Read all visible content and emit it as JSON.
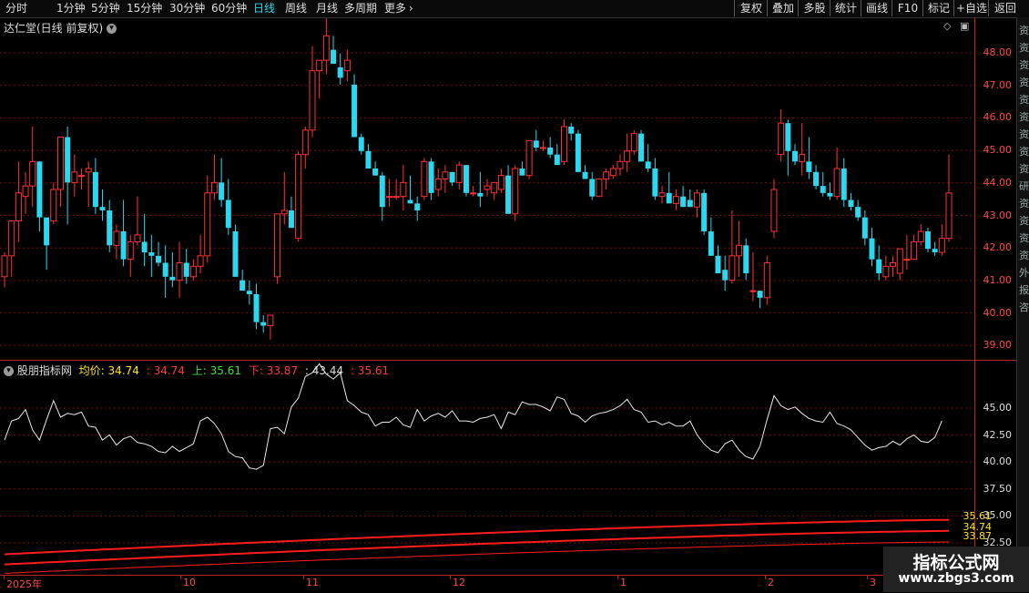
{
  "toolbar": {
    "periods": [
      "分时",
      "1分钟",
      "5分钟",
      "15分钟",
      "30分钟",
      "60分钟",
      "日线",
      "周线",
      "月线",
      "多周期",
      "更多"
    ],
    "active_period": "日线",
    "more_arrow": "›",
    "buttons": [
      "复权",
      "叠加",
      "多股",
      "统计",
      "画线",
      "F10",
      "标记",
      "+自选",
      "返回"
    ]
  },
  "stock": {
    "title": "达仁堂(日线 前复权)",
    "chevron_icon": "chevron-down-icon"
  },
  "top_right_icons": {
    "diamond": "◇",
    "panel": "▣"
  },
  "indicator": {
    "name": "股朋指标网",
    "avg_label": "均价:",
    "avg_value": "34.74",
    "val2": ": 34.74",
    "up_label": "上:",
    "up_value": "35.61",
    "down_label": "下:",
    "down_value": "33.87",
    "val5": ": 43.44",
    "val6": ": 35.61",
    "right_values": [
      "35.61",
      "34.74",
      "33.87"
    ]
  },
  "axes": {
    "price_ticks": [
      "48.00",
      "47.00",
      "46.00",
      "45.00",
      "44.00",
      "43.00",
      "42.00",
      "41.00",
      "40.00",
      "39.00"
    ],
    "indicator_ticks": [
      "45.00",
      "42.50",
      "40.00",
      "37.50",
      "35.00",
      "32.50"
    ],
    "dates": [
      "2025年",
      "10",
      "11",
      "12",
      "1",
      "2",
      "3"
    ]
  },
  "watermark": {
    "title": "指标公式网",
    "url": "www.zbgs3.com"
  },
  "side_strip": [
    "资",
    "资",
    "资",
    "资",
    "资",
    "资",
    "资",
    "资",
    "资",
    "研",
    "资",
    "资",
    "资",
    "资",
    "外",
    "报",
    "咨"
  ],
  "colors": {
    "up": "#ff3232",
    "down": "#2ad8f0",
    "grid": "#7a0e0e",
    "axis": "#b22222",
    "price_line": "#e8e8e8",
    "band": "#ff1c1c",
    "yellow": "#ffe21c"
  },
  "chart_data": [
    {
      "type": "candlestick",
      "title": "达仁堂(日线 前复权)",
      "ylim": [
        38.7,
        48.3
      ],
      "x_labels": [
        "2025年",
        "10",
        "11",
        "12",
        "1",
        "2",
        "3"
      ],
      "ohlc": [
        [
          41.0,
          41.7,
          40.7,
          41.6
        ],
        [
          41.6,
          42.6,
          41.0,
          42.6
        ],
        [
          42.6,
          44.3,
          42.0,
          43.4
        ],
        [
          43.3,
          44.0,
          42.8,
          43.6
        ],
        [
          43.6,
          45.3,
          43.0,
          44.3
        ],
        [
          44.3,
          44.3,
          42.3,
          42.7
        ],
        [
          42.7,
          42.7,
          41.2,
          41.9
        ],
        [
          42.6,
          43.7,
          42.5,
          43.5
        ],
        [
          43.5,
          45.0,
          43.0,
          45.0
        ],
        [
          45.0,
          45.3,
          42.5,
          43.7
        ],
        [
          43.7,
          44.5,
          43.3,
          44.0
        ],
        [
          43.9,
          44.1,
          43.5,
          43.9
        ],
        [
          44.0,
          44.3,
          43.0,
          44.1
        ],
        [
          44.0,
          44.4,
          42.8,
          43.0
        ],
        [
          43.0,
          43.5,
          42.6,
          42.9
        ],
        [
          42.9,
          43.2,
          41.7,
          41.9
        ],
        [
          41.9,
          42.5,
          41.5,
          42.3
        ],
        [
          42.3,
          43.2,
          41.3,
          41.5
        ],
        [
          41.5,
          42.2,
          41.0,
          42.0
        ],
        [
          42.0,
          43.3,
          41.9,
          42.2
        ],
        [
          42.0,
          42.8,
          41.3,
          41.7
        ],
        [
          41.7,
          42.2,
          41.0,
          41.6
        ],
        [
          41.6,
          42.0,
          41.3,
          41.4
        ],
        [
          41.4,
          41.9,
          40.4,
          41.0
        ],
        [
          41.0,
          41.7,
          40.7,
          40.9
        ],
        [
          40.9,
          42.0,
          40.4,
          41.4
        ],
        [
          41.4,
          41.8,
          40.8,
          41.0
        ],
        [
          41.0,
          41.5,
          40.9,
          41.3
        ],
        [
          41.3,
          42.2,
          41.1,
          41.6
        ],
        [
          41.6,
          43.9,
          41.4,
          43.4
        ],
        [
          43.4,
          44.5,
          43.2,
          43.7
        ],
        [
          43.7,
          44.4,
          43.0,
          43.2
        ],
        [
          43.2,
          43.8,
          42.2,
          42.4
        ],
        [
          42.3,
          42.5,
          41.0,
          41.0
        ],
        [
          40.9,
          41.2,
          40.7,
          40.6
        ],
        [
          40.6,
          40.9,
          40.2,
          40.5
        ],
        [
          40.5,
          40.8,
          39.5,
          39.7
        ],
        [
          39.7,
          39.9,
          39.4,
          39.6
        ],
        [
          39.6,
          39.9,
          39.2,
          39.9
        ],
        [
          41.0,
          42.8,
          40.8,
          42.8
        ],
        [
          42.8,
          44.0,
          42.5,
          42.9
        ],
        [
          42.9,
          43.3,
          42.4,
          42.4
        ],
        [
          42.1,
          44.6,
          42.0,
          44.5
        ],
        [
          44.5,
          45.3,
          44.1,
          45.2
        ],
        [
          45.2,
          47.6,
          45.0,
          46.9
        ],
        [
          46.9,
          47.2,
          46.1,
          47.2
        ],
        [
          47.2,
          48.4,
          46.8,
          47.9
        ],
        [
          47.5,
          47.9,
          47.2,
          47.1
        ],
        [
          47.0,
          47.4,
          46.5,
          46.7
        ],
        [
          46.9,
          47.5,
          46.6,
          47.2
        ],
        [
          46.5,
          46.8,
          45.3,
          45.0
        ],
        [
          45.0,
          45.1,
          44.5,
          44.6
        ],
        [
          44.6,
          44.8,
          44.2,
          44.1
        ],
        [
          44.1,
          44.3,
          43.9,
          43.9
        ],
        [
          43.9,
          44.0,
          42.6,
          43.0
        ],
        [
          43.3,
          43.8,
          43.0,
          43.3
        ],
        [
          43.3,
          43.8,
          43.2,
          43.3
        ],
        [
          43.3,
          44.2,
          42.9,
          43.7
        ],
        [
          43.2,
          43.9,
          43.1,
          43.1
        ],
        [
          43.1,
          43.3,
          42.6,
          42.9
        ],
        [
          43.3,
          44.4,
          43.2,
          44.3
        ],
        [
          44.3,
          44.4,
          43.2,
          43.4
        ],
        [
          43.5,
          44.1,
          43.3,
          43.8
        ],
        [
          43.8,
          44.2,
          43.4,
          44.0
        ],
        [
          44.0,
          44.0,
          43.6,
          43.7
        ],
        [
          43.7,
          44.3,
          43.5,
          44.2
        ],
        [
          44.2,
          44.2,
          43.3,
          43.4
        ],
        [
          43.4,
          43.6,
          43.3,
          43.4
        ],
        [
          43.4,
          44.0,
          43.0,
          43.3
        ],
        [
          43.5,
          43.8,
          43.3,
          43.6
        ],
        [
          43.4,
          43.7,
          43.2,
          43.7
        ],
        [
          43.5,
          44.1,
          43.4,
          43.9
        ],
        [
          43.9,
          44.2,
          43.1,
          42.8
        ],
        [
          42.8,
          44.2,
          42.6,
          44.1
        ],
        [
          44.1,
          44.3,
          43.9,
          43.9
        ],
        [
          43.9,
          44.9,
          43.8,
          44.9
        ],
        [
          44.9,
          45.2,
          44.6,
          44.7
        ],
        [
          44.7,
          44.9,
          44.6,
          44.7
        ],
        [
          44.7,
          45.0,
          44.4,
          44.5
        ],
        [
          44.5,
          44.8,
          44.3,
          44.2
        ],
        [
          44.3,
          45.5,
          44.2,
          45.3
        ],
        [
          45.3,
          45.4,
          44.9,
          45.1
        ],
        [
          45.1,
          45.2,
          44.1,
          44.0
        ],
        [
          44.0,
          44.2,
          43.9,
          43.8
        ],
        [
          43.8,
          44.0,
          43.2,
          43.3
        ],
        [
          43.3,
          43.8,
          43.3,
          43.8
        ],
        [
          43.8,
          44.1,
          43.5,
          44.0
        ],
        [
          43.9,
          44.2,
          43.8,
          44.1
        ],
        [
          44.1,
          44.5,
          43.9,
          44.3
        ],
        [
          44.3,
          45.1,
          44.0,
          44.6
        ],
        [
          44.6,
          45.2,
          44.5,
          45.1
        ],
        [
          45.1,
          45.2,
          44.3,
          44.3
        ],
        [
          44.3,
          44.8,
          44.0,
          44.1
        ],
        [
          44.1,
          44.4,
          43.2,
          43.3
        ],
        [
          43.3,
          43.6,
          43.1,
          43.4
        ],
        [
          43.4,
          44.0,
          43.2,
          43.1
        ],
        [
          43.1,
          43.5,
          42.9,
          43.3
        ],
        [
          43.3,
          43.6,
          43.0,
          43.0
        ],
        [
          43.2,
          43.5,
          43.0,
          43.0
        ],
        [
          43.0,
          43.5,
          42.7,
          43.4
        ],
        [
          43.4,
          43.5,
          42.2,
          42.3
        ],
        [
          42.3,
          42.7,
          41.7,
          41.6
        ],
        [
          41.6,
          41.9,
          41.4,
          41.1
        ],
        [
          41.2,
          41.6,
          40.6,
          40.9
        ],
        [
          40.9,
          42.9,
          40.8,
          41.6
        ],
        [
          41.6,
          42.6,
          41.0,
          41.9
        ],
        [
          41.9,
          42.1,
          40.9,
          41.1
        ],
        [
          40.6,
          41.7,
          40.3,
          40.6
        ],
        [
          40.6,
          40.6,
          40.1,
          40.4
        ],
        [
          40.4,
          41.6,
          40.2,
          41.4
        ],
        [
          42.3,
          43.8,
          42.1,
          43.5
        ],
        [
          44.5,
          45.8,
          44.3,
          45.4
        ],
        [
          45.4,
          45.5,
          43.9,
          44.6
        ],
        [
          44.6,
          44.8,
          44.2,
          44.3
        ],
        [
          44.3,
          45.4,
          43.9,
          44.5
        ],
        [
          44.3,
          45.0,
          43.8,
          44.0
        ],
        [
          44.0,
          44.2,
          43.5,
          43.6
        ],
        [
          43.6,
          44.0,
          43.3,
          43.4
        ],
        [
          43.4,
          43.7,
          43.2,
          43.3
        ],
        [
          43.3,
          44.7,
          43.2,
          44.1
        ],
        [
          44.1,
          44.4,
          43.0,
          43.2
        ],
        [
          43.2,
          43.4,
          42.9,
          43.0
        ],
        [
          43.0,
          43.2,
          42.6,
          42.7
        ],
        [
          42.7,
          42.9,
          41.9,
          42.1
        ],
        [
          42.1,
          42.4,
          41.3,
          41.5
        ],
        [
          41.5,
          41.9,
          40.9,
          41.1
        ],
        [
          41.0,
          41.6,
          40.9,
          41.3
        ],
        [
          41.3,
          41.6,
          41.0,
          41.4
        ],
        [
          41.1,
          41.8,
          40.9,
          41.8
        ],
        [
          41.5,
          42.2,
          41.2,
          41.5
        ],
        [
          41.5,
          42.2,
          41.5,
          42.0
        ],
        [
          42.0,
          42.5,
          41.9,
          42.3
        ],
        [
          42.3,
          42.4,
          41.7,
          41.8
        ],
        [
          41.8,
          42.0,
          41.6,
          41.7
        ],
        [
          41.7,
          42.5,
          41.6,
          42.1
        ],
        [
          42.1,
          44.5,
          42.0,
          43.4
        ]
      ]
    },
    {
      "type": "line",
      "title": "股朋指标网",
      "ylim": [
        31.5,
        47.5
      ],
      "series": [
        {
          "name": "43.44",
          "values": [
            41.9,
            43.4,
            43.6,
            44.3,
            42.7,
            41.9,
            43.5,
            45.0,
            43.7,
            44.0,
            43.9,
            44.1,
            43.0,
            42.9,
            41.9,
            42.3,
            41.5,
            42.0,
            42.2,
            41.7,
            41.6,
            41.4,
            41.0,
            40.9,
            41.4,
            41.0,
            41.3,
            41.6,
            43.4,
            43.7,
            43.2,
            42.4,
            41.0,
            40.6,
            40.5,
            39.7,
            39.6,
            39.9,
            42.8,
            42.9,
            42.4,
            44.5,
            45.2,
            46.9,
            47.2,
            47.9,
            47.1,
            46.7,
            47.2,
            45.0,
            44.6,
            44.1,
            43.9,
            43.0,
            43.3,
            43.3,
            43.7,
            43.1,
            42.9,
            44.3,
            43.4,
            43.8,
            44.0,
            43.7,
            44.2,
            43.4,
            43.4,
            43.3,
            43.6,
            43.7,
            43.9,
            42.8,
            44.1,
            43.9,
            44.9,
            44.7,
            44.7,
            44.5,
            44.2,
            45.3,
            45.1,
            44.0,
            43.8,
            43.3,
            43.8,
            44.0,
            44.1,
            44.3,
            44.6,
            45.1,
            44.3,
            44.1,
            43.3,
            43.4,
            43.1,
            43.3,
            43.0,
            43.0,
            43.4,
            42.3,
            41.6,
            41.1,
            40.9,
            41.6,
            41.9,
            41.1,
            40.6,
            40.4,
            41.4,
            43.5,
            45.4,
            44.6,
            44.3,
            44.5,
            44.0,
            43.6,
            43.4,
            43.3,
            44.1,
            43.2,
            43.0,
            42.7,
            42.1,
            41.5,
            41.1,
            41.3,
            41.4,
            41.8,
            41.5,
            42.0,
            42.3,
            41.8,
            41.7,
            42.1,
            43.4
          ]
        },
        {
          "name": "上",
          "values": [
            32.9,
            35.61
          ]
        },
        {
          "name": "均价",
          "values": [
            32.1,
            34.74
          ]
        },
        {
          "name": "下",
          "values": [
            31.4,
            33.87
          ]
        }
      ]
    }
  ]
}
